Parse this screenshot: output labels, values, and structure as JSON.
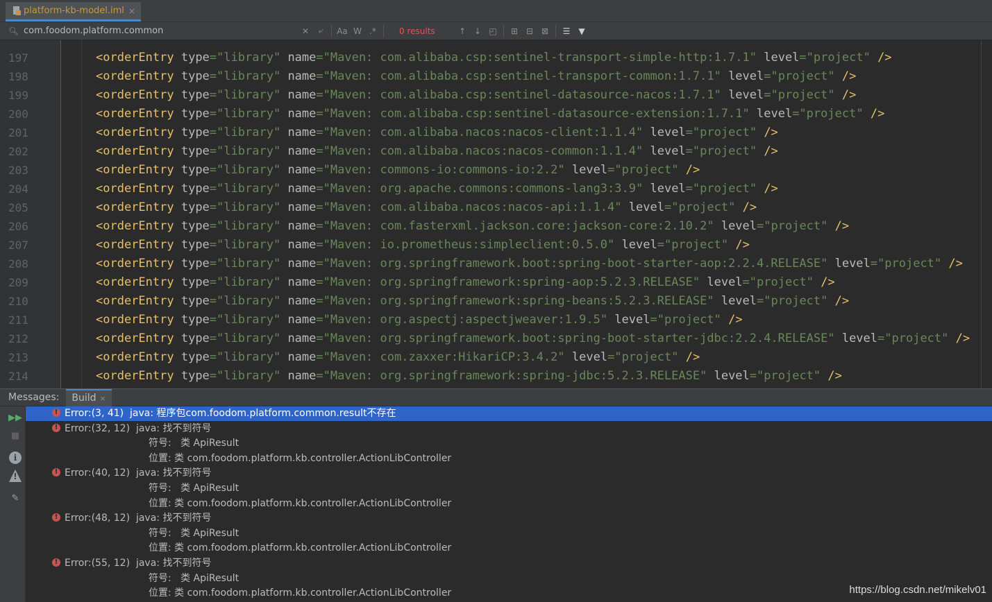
{
  "tab": {
    "label": "platform-kb-model.iml",
    "close": "×",
    "icon": "xml-file-icon"
  },
  "find": {
    "query": "com.foodom.platform.common",
    "results": "0 results",
    "opt_case": "Aa",
    "opt_words": "W",
    "opt_regex": ".*"
  },
  "editor": {
    "lines": [
      {
        "n": "197",
        "name": "Maven: com.alibaba.csp:sentinel-transport-simple-http:1.7.1",
        "level": "project"
      },
      {
        "n": "198",
        "name": "Maven: com.alibaba.csp:sentinel-transport-common:1.7.1",
        "level": "project"
      },
      {
        "n": "199",
        "name": "Maven: com.alibaba.csp:sentinel-datasource-nacos:1.7.1",
        "level": "project"
      },
      {
        "n": "200",
        "name": "Maven: com.alibaba.csp:sentinel-datasource-extension:1.7.1",
        "level": "project"
      },
      {
        "n": "201",
        "name": "Maven: com.alibaba.nacos:nacos-client:1.1.4",
        "level": "project"
      },
      {
        "n": "202",
        "name": "Maven: com.alibaba.nacos:nacos-common:1.1.4",
        "level": "project"
      },
      {
        "n": "203",
        "name": "Maven: commons-io:commons-io:2.2",
        "level": "project"
      },
      {
        "n": "204",
        "name": "Maven: org.apache.commons:commons-lang3:3.9",
        "level": "project"
      },
      {
        "n": "205",
        "name": "Maven: com.alibaba.nacos:nacos-api:1.1.4",
        "level": "project"
      },
      {
        "n": "206",
        "name": "Maven: com.fasterxml.jackson.core:jackson-core:2.10.2",
        "level": "project"
      },
      {
        "n": "207",
        "name": "Maven: io.prometheus:simpleclient:0.5.0",
        "level": "project"
      },
      {
        "n": "208",
        "name": "Maven: org.springframework.boot:spring-boot-starter-aop:2.2.4.RELEASE",
        "level": "project"
      },
      {
        "n": "209",
        "name": "Maven: org.springframework:spring-aop:5.2.3.RELEASE",
        "level": "project"
      },
      {
        "n": "210",
        "name": "Maven: org.springframework:spring-beans:5.2.3.RELEASE",
        "level": "project"
      },
      {
        "n": "211",
        "name": "Maven: org.aspectj:aspectjweaver:1.9.5",
        "level": "project"
      },
      {
        "n": "212",
        "name": "Maven: org.springframework.boot:spring-boot-starter-jdbc:2.2.4.RELEASE",
        "level": "project"
      },
      {
        "n": "213",
        "name": "Maven: com.zaxxer:HikariCP:3.4.2",
        "level": "project"
      },
      {
        "n": "214",
        "name": "Maven: org.springframework:spring-jdbc:5.2.3.RELEASE",
        "level": "project"
      }
    ],
    "tag": "<orderEntry",
    "type_value": "library",
    "close": "/>"
  },
  "messages": {
    "label": "Messages:",
    "tab": "Build",
    "tab_close": "×",
    "rows": [
      {
        "kind": "error",
        "text": "Error:(3, 41)  java: 程序包com.foodom.platform.common.result不存在",
        "selected": true
      },
      {
        "kind": "error",
        "text": "Error:(32, 12)  java: 找不到符号"
      },
      {
        "kind": "detail",
        "text": "符号:   类 ApiResult"
      },
      {
        "kind": "detail",
        "text": "位置: 类 com.foodom.platform.kb.controller.ActionLibController"
      },
      {
        "kind": "error",
        "text": "Error:(40, 12)  java: 找不到符号"
      },
      {
        "kind": "detail",
        "text": "符号:   类 ApiResult"
      },
      {
        "kind": "detail",
        "text": "位置: 类 com.foodom.platform.kb.controller.ActionLibController"
      },
      {
        "kind": "error",
        "text": "Error:(48, 12)  java: 找不到符号"
      },
      {
        "kind": "detail",
        "text": "符号:   类 ApiResult"
      },
      {
        "kind": "detail",
        "text": "位置: 类 com.foodom.platform.kb.controller.ActionLibController"
      },
      {
        "kind": "error",
        "text": "Error:(55, 12)  java: 找不到符号"
      },
      {
        "kind": "detail",
        "text": "符号:   类 ApiResult"
      },
      {
        "kind": "detail",
        "text": "位置: 类 com.foodom.platform.kb.controller.ActionLibController"
      }
    ]
  },
  "colors": {
    "accent": "#4a88c7",
    "selection": "#2f65ca",
    "error": "#c75450",
    "tag": "#e8bf6a",
    "string": "#6a8759"
  },
  "watermark": "https://blog.csdn.net/mikelv01"
}
